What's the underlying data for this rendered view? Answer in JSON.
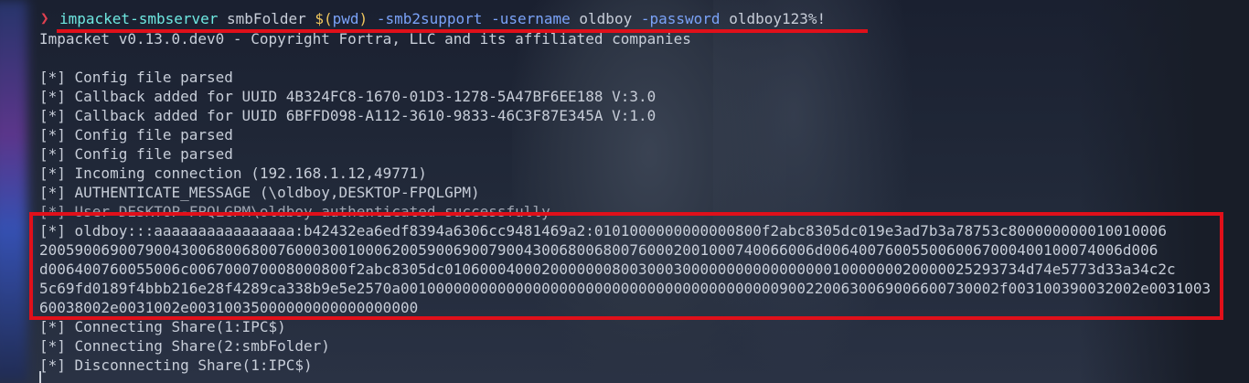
{
  "command": {
    "prompt_symbol": "❯",
    "program": "impacket-smbserver",
    "share_name": "smbFolder",
    "path_expr_open": "$(",
    "path_expr_cmd": "pwd",
    "path_expr_close": ")",
    "flag_smb2": "-smb2support",
    "flag_username": "-username",
    "username": "oldboy",
    "flag_password": "-password",
    "password": "oldboy123%!"
  },
  "output": [
    "Impacket v0.13.0.dev0 - Copyright Fortra, LLC and its affiliated companies",
    "",
    "[*] Config file parsed",
    "[*] Callback added for UUID 4B324FC8-1670-01D3-1278-5A47BF6EE188 V:3.0",
    "[*] Callback added for UUID 6BFFD098-A112-3610-9833-46C3F87E345A V:1.0",
    "[*] Config file parsed",
    "[*] Config file parsed",
    "[*] Incoming connection (192.168.1.12,49771)",
    "[*] AUTHENTICATE_MESSAGE (\\oldboy,DESKTOP-FPQLGPM)",
    "[*] User DESKTOP-FPQLGPM\\oldboy authenticated successfully"
  ],
  "hash_lines": [
    "[*] oldboy:::aaaaaaaaaaaaaaaa:b42432ea6edf8394a6306cc9481469a2:0101000000000000800f2abc8305dc019e3ad7b3a78753c800000000010010006",
    "2005900690079004300680068007600030010006200590069007900430068006800760002001000740066006d0064007600550060067000400100074006d006",
    "d006400760055006c006700070008000800f2abc8305dc010600040002000000080030003000000000000000001000000020000025293734d74e5773d33a34c2c",
    "5c69fd0189f4bbb216e28f4289ca338b9e5e2570a00100000000000000000000000000000000000000009002200630069006600730002f003100390032002e0031003",
    "60038002e0031002e00310035000000000000000000"
  ],
  "trailing": [
    "[*] Connecting Share(1:IPC$)",
    "[*] Connecting Share(2:smbFolder)",
    "[*] Disconnecting Share(1:IPC$)"
  ],
  "colors": {
    "highlight_red": "#e0101a",
    "command_cyan": "#6ee7e0",
    "flag_blue": "#7aa2f7",
    "subshell_yellow": "#f0c75e",
    "prompt_red": "#e04050"
  }
}
